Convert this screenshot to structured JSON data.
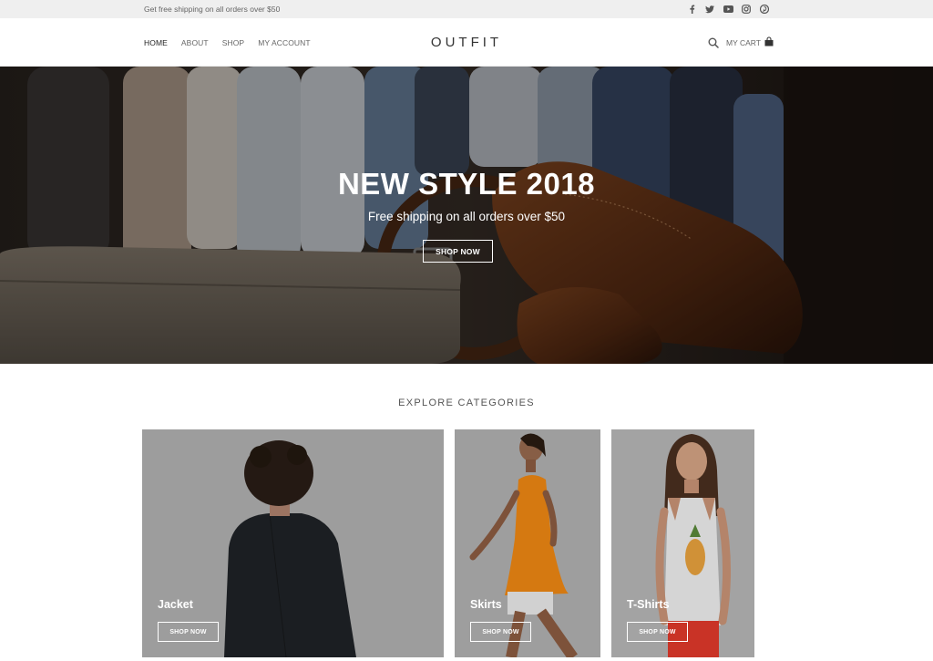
{
  "topbar": {
    "message": "Get free shipping on all orders over $50",
    "social_icons": [
      "facebook-icon",
      "twitter-icon",
      "youtube-icon",
      "instagram-icon",
      "pinterest-icon"
    ]
  },
  "header": {
    "nav": [
      "HOME",
      "ABOUT",
      "SHOP",
      "MY ACCOUNT"
    ],
    "active_nav": "HOME",
    "logo": "OUTFIT",
    "cart_label": "MY CART",
    "icons": [
      "search-icon",
      "shopping-bag-icon"
    ]
  },
  "hero": {
    "title": "NEW STYLE 2018",
    "subtitle": "Free shipping on all orders over $50",
    "button": "SHOP NOW"
  },
  "categories": {
    "heading": "EXPLORE CATEGORIES",
    "items": [
      {
        "label": "Jacket",
        "button": "SHOP NOW"
      },
      {
        "label": "Skirts",
        "button": "SHOP NOW"
      },
      {
        "label": "T-Shirts",
        "button": "SHOP NOW"
      }
    ]
  },
  "colors": {
    "topbar_bg": "#efefef",
    "text_dark": "#333333",
    "card_bg": "#b5b5b5",
    "skirt_orange": "#f38a14",
    "white": "#ffffff"
  }
}
